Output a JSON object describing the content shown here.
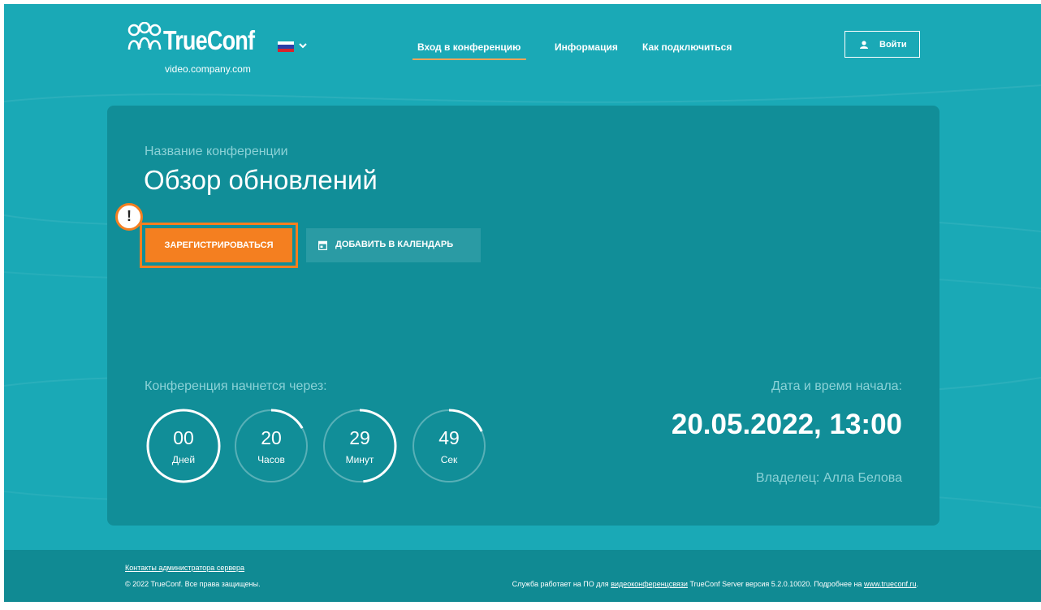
{
  "header": {
    "logo_text": "TrueConf",
    "server_domain": "video.company.com",
    "language_flag": "ru-flag-icon",
    "nav": [
      {
        "label": "Вход в конференцию",
        "active": true
      },
      {
        "label": "Информация",
        "active": false
      },
      {
        "label": "Как подключиться",
        "active": false
      }
    ],
    "login_label": "Войти"
  },
  "conference": {
    "name_label": "Название конференции",
    "name": "Обзор обновлений",
    "alert_mark": "!",
    "register_label": "ЗАРЕГИСТРИРОВАТЬСЯ",
    "calendar_label": "ДОБАВИТЬ В КАЛЕНДАРЬ",
    "countdown_label": "Конференция начнется через:",
    "countdown": [
      {
        "value": "00",
        "unit": "Дней",
        "progress": 1.0
      },
      {
        "value": "20",
        "unit": "Часов",
        "progress": 0.167
      },
      {
        "value": "29",
        "unit": "Минут",
        "progress": 0.483
      },
      {
        "value": "49",
        "unit": "Сек",
        "progress": 0.183
      }
    ],
    "start_label": "Дата и время начала:",
    "start_value": "20.05.2022, 13:00",
    "owner_label": "Владелец:",
    "owner_name": "Алла Белова"
  },
  "footer": {
    "contacts_link": "Контакты администратора сервера",
    "copyright": "© 2022 TrueConf. Все права защищены.",
    "service_prefix": "Служба работает на ПО для",
    "service_link": "видеоконференцсвязи",
    "service_middle": "TrueConf Server версия 5.2.0.10020. Подробнее на",
    "site_link": "www.trueconf.ru",
    "service_suffix": "."
  },
  "colors": {
    "background": "#1aa9b6",
    "card": "#118e98",
    "accent": "#f47f20",
    "footer": "#108a93"
  }
}
